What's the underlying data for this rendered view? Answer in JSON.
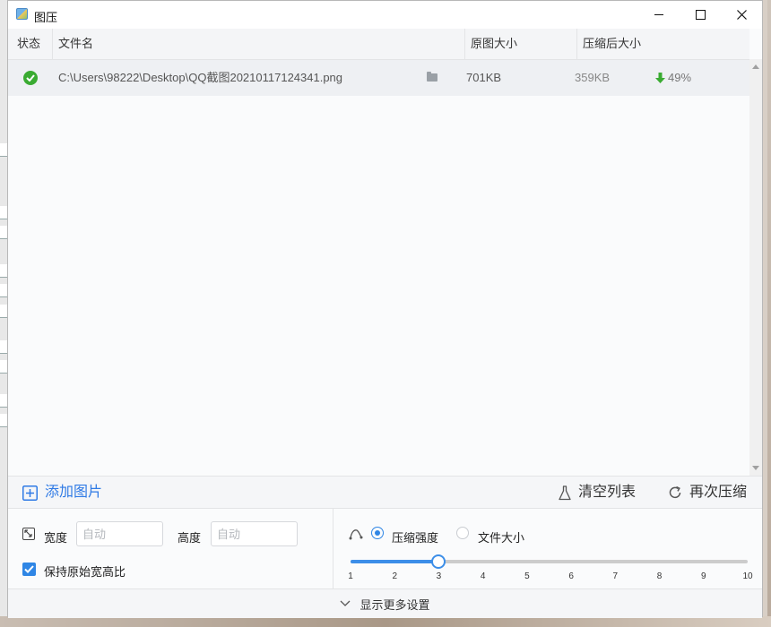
{
  "window": {
    "title": "图压"
  },
  "table": {
    "columns": {
      "status": "状态",
      "filename": "文件名",
      "original_size": "原图大小",
      "compressed_size": "压缩后大小"
    },
    "rows": [
      {
        "path": "C:\\Users\\98222\\Desktop\\QQ截图20210117124341.png",
        "original_size": "701KB",
        "compressed_size": "359KB",
        "reduction": "49%",
        "status_icon": "check-circle-icon"
      }
    ]
  },
  "actions": {
    "add": "添加图片",
    "clear": "清空列表",
    "recompress": "再次压缩"
  },
  "settings": {
    "width_label": "宽度",
    "width_placeholder": "自动",
    "height_label": "高度",
    "height_placeholder": "自动",
    "keep_ratio_label": "保持原始宽高比",
    "keep_ratio_checked": true,
    "mode_strength_label": "压缩强度",
    "mode_size_label": "文件大小",
    "selected_mode": "strength",
    "slider": {
      "min": 1,
      "max": 10,
      "value": 3,
      "ticks": [
        "1",
        "2",
        "3",
        "4",
        "5",
        "6",
        "7",
        "8",
        "9",
        "10"
      ]
    }
  },
  "footer": {
    "more_settings": "显示更多设置"
  },
  "colors": {
    "accent": "#2f86e5",
    "success": "#3aab32"
  }
}
